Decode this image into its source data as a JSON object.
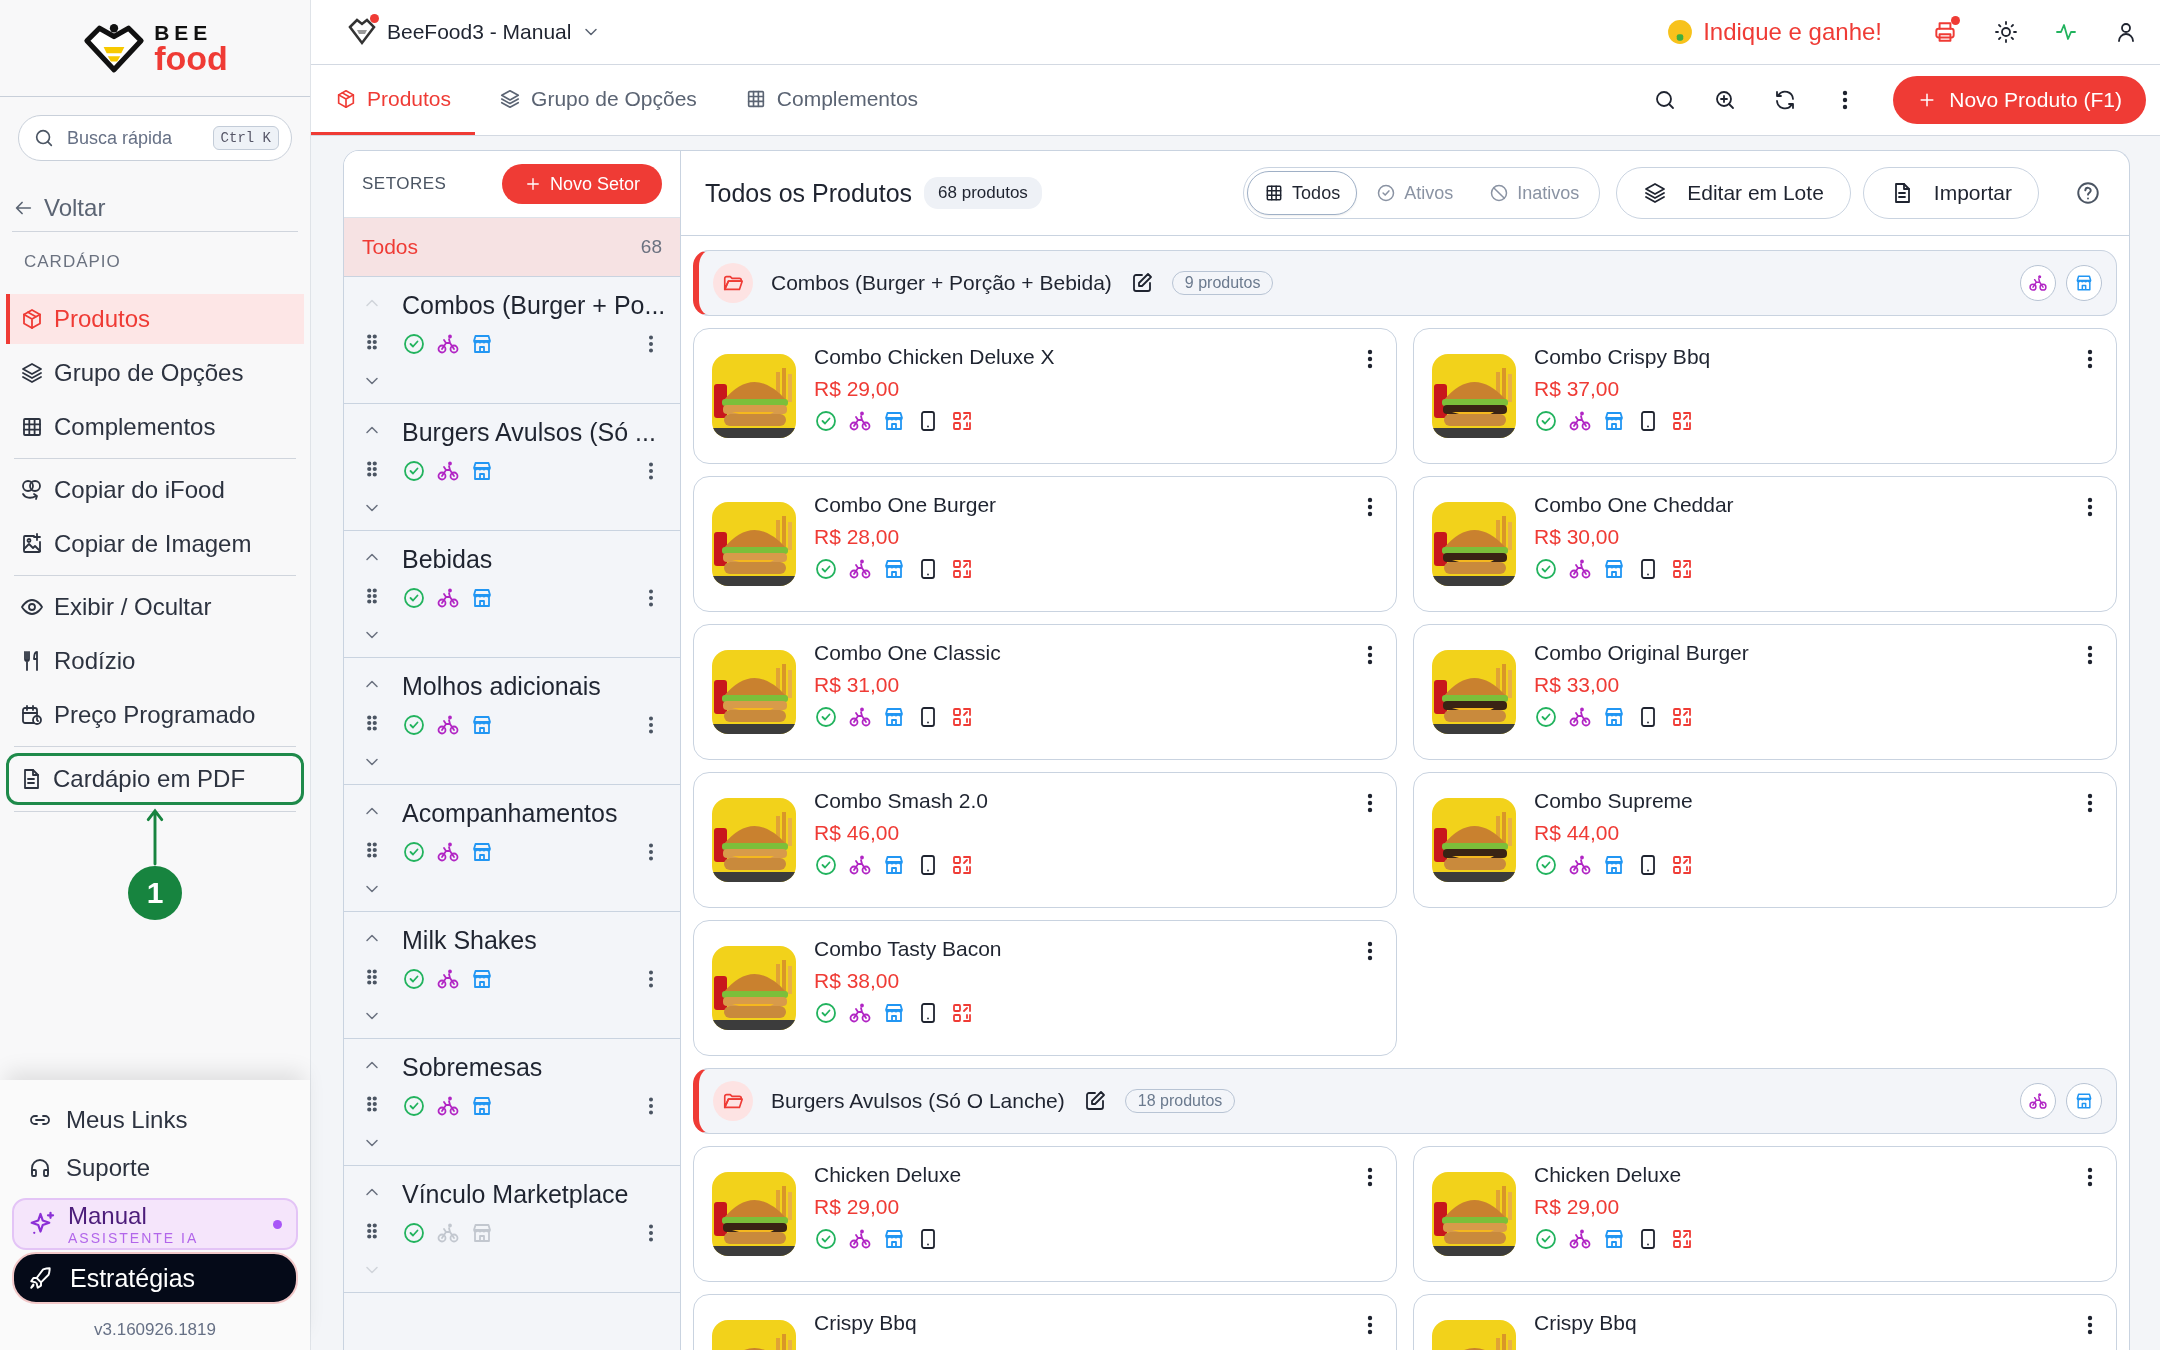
{
  "sidebar": {
    "logo": {
      "top": "BEE",
      "bottom": "food"
    },
    "search": {
      "placeholder": "Busca rápida",
      "shortcut": "Ctrl K"
    },
    "back": "Voltar",
    "section_title": "CARDÁPIO",
    "menu_groups": [
      [
        {
          "label": "Produtos",
          "selected": true,
          "highlighted": false
        },
        {
          "label": "Grupo de Opções",
          "selected": false,
          "highlighted": false
        },
        {
          "label": "Complementos",
          "selected": false,
          "highlighted": false
        }
      ],
      [
        {
          "label": "Copiar do iFood",
          "selected": false,
          "highlighted": false
        },
        {
          "label": "Copiar de Imagem",
          "selected": false,
          "highlighted": false
        }
      ],
      [
        {
          "label": "Exibir / Ocultar",
          "selected": false,
          "highlighted": false
        },
        {
          "label": "Rodízio",
          "selected": false,
          "highlighted": false
        },
        {
          "label": "Preço Programado",
          "selected": false,
          "highlighted": false
        }
      ],
      [
        {
          "label": "Cardápio em PDF",
          "selected": false,
          "highlighted": true
        }
      ]
    ],
    "callout": {
      "number": "1"
    },
    "footer_links": [
      "Meus Links",
      "Suporte"
    ],
    "assistant": {
      "title": "Manual",
      "subtitle": "ASSISTENTE IA"
    },
    "strategies": "Estratégias",
    "version": "v3.160926.1819"
  },
  "topbar": {
    "store": "BeeFood3 - Manual",
    "referral": "Indique e ganhe!"
  },
  "tabs": [
    {
      "label": "Produtos",
      "selected": true
    },
    {
      "label": "Grupo de Opções",
      "selected": false
    },
    {
      "label": "Complementos",
      "selected": false
    }
  ],
  "new_product_button": "Novo Produto (F1)",
  "sectors": {
    "title": "SETORES",
    "new_button": "Novo Setor",
    "all": {
      "label": "Todos",
      "count": "68",
      "selected": true
    },
    "items": [
      {
        "name": "Combos (Burger + Po...",
        "can_move_up": false,
        "can_move_down": true,
        "active": true,
        "delivery": true,
        "store": true
      },
      {
        "name": "Burgers Avulsos (Só ...",
        "can_move_up": true,
        "can_move_down": true,
        "active": true,
        "delivery": true,
        "store": true
      },
      {
        "name": "Bebidas",
        "can_move_up": true,
        "can_move_down": true,
        "active": true,
        "delivery": true,
        "store": true
      },
      {
        "name": "Molhos adicionais",
        "can_move_up": true,
        "can_move_down": true,
        "active": true,
        "delivery": true,
        "store": true
      },
      {
        "name": "Acompanhamentos",
        "can_move_up": true,
        "can_move_down": true,
        "active": true,
        "delivery": true,
        "store": true
      },
      {
        "name": "Milk Shakes",
        "can_move_up": true,
        "can_move_down": true,
        "active": true,
        "delivery": true,
        "store": true
      },
      {
        "name": "Sobremesas",
        "can_move_up": true,
        "can_move_down": true,
        "active": true,
        "delivery": true,
        "store": true
      },
      {
        "name": "Vínculo Marketplace",
        "can_move_up": true,
        "can_move_down": false,
        "active": true,
        "delivery": false,
        "store": false
      }
    ]
  },
  "products": {
    "title": "Todos os Produtos",
    "count": "68 produtos",
    "filters": [
      {
        "label": "Todos",
        "selected": true
      },
      {
        "label": "Ativos",
        "selected": false
      },
      {
        "label": "Inativos",
        "selected": false
      }
    ],
    "actions": [
      "Editar em Lote",
      "Importar"
    ],
    "groups": [
      {
        "name": "Combos (Burger + Porção + Bebida)",
        "count": "9 produtos",
        "delivery": true,
        "store": true,
        "items": [
          {
            "name": "Combo Chicken Deluxe X",
            "price": "R$ 29,00",
            "active": true,
            "delivery": true,
            "store": true,
            "tablet": true,
            "qr": true
          },
          {
            "name": "Combo Crispy Bbq",
            "price": "R$ 37,00",
            "active": true,
            "delivery": true,
            "store": true,
            "tablet": true,
            "qr": true
          },
          {
            "name": "Combo One Burger",
            "price": "R$ 28,00",
            "active": true,
            "delivery": true,
            "store": true,
            "tablet": true,
            "qr": true
          },
          {
            "name": "Combo One Cheddar",
            "price": "R$ 30,00",
            "active": true,
            "delivery": true,
            "store": true,
            "tablet": true,
            "qr": true
          },
          {
            "name": "Combo One Classic",
            "price": "R$ 31,00",
            "active": true,
            "delivery": true,
            "store": true,
            "tablet": true,
            "qr": true
          },
          {
            "name": "Combo Original Burger",
            "price": "R$ 33,00",
            "active": true,
            "delivery": true,
            "store": true,
            "tablet": true,
            "qr": true
          },
          {
            "name": "Combo Smash 2.0",
            "price": "R$ 46,00",
            "active": true,
            "delivery": true,
            "store": true,
            "tablet": true,
            "qr": true
          },
          {
            "name": "Combo Supreme",
            "price": "R$ 44,00",
            "active": true,
            "delivery": true,
            "store": true,
            "tablet": true,
            "qr": true
          },
          {
            "name": "Combo Tasty Bacon",
            "price": "R$ 38,00",
            "active": true,
            "delivery": true,
            "store": true,
            "tablet": true,
            "qr": true
          }
        ]
      },
      {
        "name": "Burgers Avulsos (Só O Lanche)",
        "count": "18 produtos",
        "delivery": true,
        "store": true,
        "items": [
          {
            "name": "Chicken Deluxe",
            "price": "R$ 29,00",
            "active": true,
            "delivery": true,
            "store": true,
            "tablet": true,
            "qr": false
          },
          {
            "name": "Chicken Deluxe",
            "price": "R$ 29,00",
            "active": true,
            "delivery": true,
            "store": true,
            "tablet": true,
            "qr": true
          },
          {
            "name": "Crispy Bbq"
          },
          {
            "name": "Crispy Bbq"
          }
        ]
      }
    ]
  }
}
